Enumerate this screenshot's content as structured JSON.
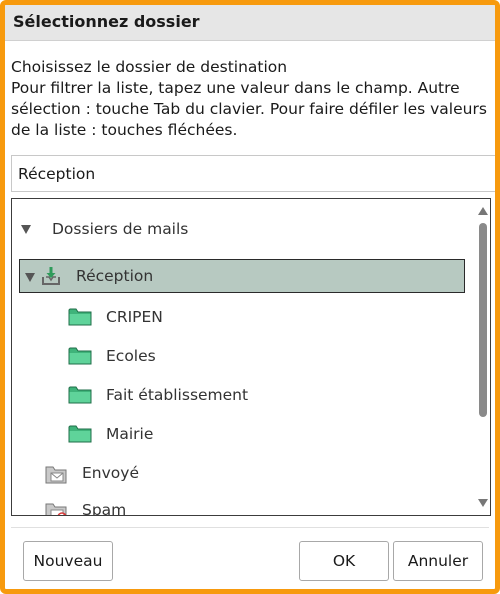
{
  "dialog": {
    "title": "Sélectionnez dossier",
    "accent_color": "#f79a0e"
  },
  "instructions": {
    "line1": "Choisissez le dossier de destination",
    "line2": "Pour filtrer la liste, tapez une valeur dans le champ. Autre",
    "line3": "sélection : touche Tab du clavier. Pour faire défiler les valeurs",
    "line4": "de la liste : touches fléchées."
  },
  "filter": {
    "value": "Réception"
  },
  "tree": {
    "root": {
      "label": "Dossiers de mails",
      "expanded": true
    },
    "inbox": {
      "label": "Réception",
      "selected": true,
      "expanded": true,
      "highlight_color": "#b7c9c1"
    },
    "subfolders": [
      {
        "label": "CRIPEN"
      },
      {
        "label": "Ecoles"
      },
      {
        "label": "Fait établissement"
      },
      {
        "label": "Mairie"
      }
    ],
    "sent": {
      "label": "Envoyé"
    },
    "spam": {
      "label": "Spam"
    },
    "folder_color": "#3fb37a"
  },
  "buttons": {
    "new": "Nouveau",
    "ok": "OK",
    "cancel": "Annuler"
  }
}
